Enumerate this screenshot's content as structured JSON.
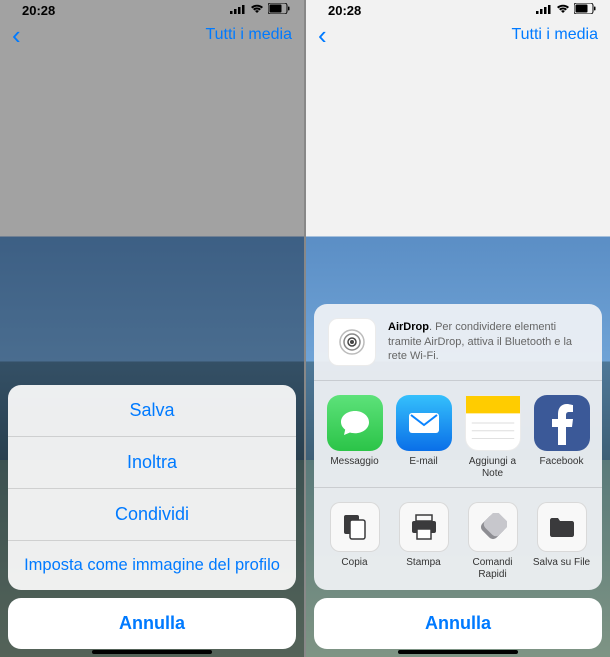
{
  "status": {
    "time": "20:28",
    "loc_icon": "✈︎"
  },
  "nav": {
    "back": "‹",
    "right_label": "Tutti i media"
  },
  "action_sheet": {
    "items": [
      {
        "label": "Salva",
        "name": "save-button"
      },
      {
        "label": "Inoltra",
        "name": "forward-button"
      },
      {
        "label": "Condividi",
        "name": "share-button"
      },
      {
        "label": "Imposta come immagine del profilo",
        "name": "set-profile-image-button"
      }
    ],
    "cancel": "Annulla"
  },
  "share": {
    "airdrop": {
      "title": "AirDrop",
      "desc": ". Per condividere elementi tramite AirDrop, attiva il Bluetooth e la rete Wi-Fi."
    },
    "apps": [
      {
        "label": "Messaggio",
        "name": "messages-app",
        "color": "#4CD964",
        "icon": "message-icon"
      },
      {
        "label": "E-mail",
        "name": "mail-app",
        "color": "#0A84FF",
        "icon": "mail-icon"
      },
      {
        "label": "Aggiungi a Note",
        "name": "notes-app",
        "color": "#FFCC00",
        "icon": "notes-icon"
      },
      {
        "label": "Facebook",
        "name": "facebook-app",
        "color": "#3B5998",
        "icon": "facebook-icon"
      }
    ],
    "actions": [
      {
        "label": "Copia",
        "name": "copy-action",
        "icon": "copy-icon"
      },
      {
        "label": "Stampa",
        "name": "print-action",
        "icon": "print-icon"
      },
      {
        "label": "Comandi Rapidi",
        "name": "shortcuts-action",
        "icon": "shortcuts-icon"
      },
      {
        "label": "Salva su File",
        "name": "save-files-action",
        "icon": "folder-icon"
      }
    ],
    "cancel": "Annulla"
  },
  "colors": {
    "tint": "#007AFF"
  }
}
